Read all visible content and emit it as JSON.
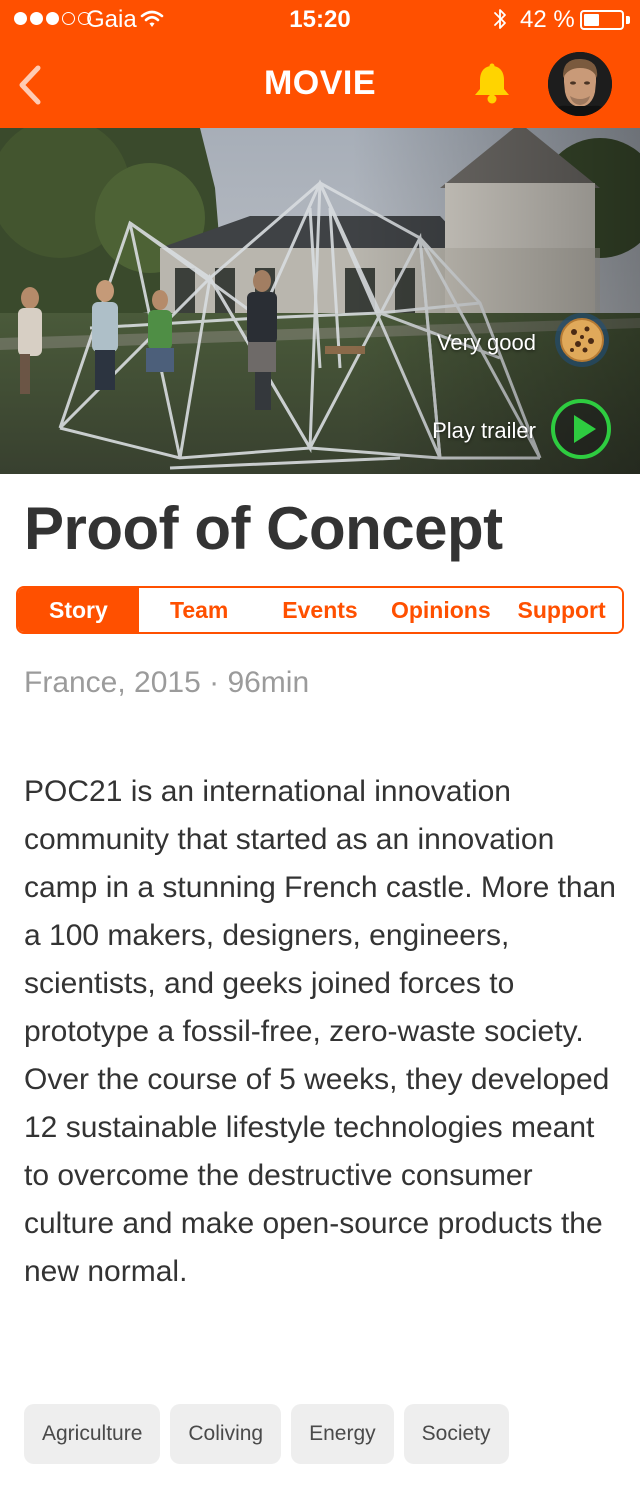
{
  "status_bar": {
    "carrier": "Gaia",
    "time": "15:20",
    "battery_percent": "42 %",
    "battery_level": 0.42,
    "signal_bars_filled": 3,
    "signal_bars_total": 5
  },
  "nav": {
    "title": "MOVIE",
    "back_icon": "chevron-left-icon",
    "bell_icon": "bell-icon",
    "accent_color": "#ff5000",
    "bell_color": "#ffd400"
  },
  "hero": {
    "rating_label": "Very good",
    "rating_icon": "cookie-icon",
    "trailer_label": "Play trailer",
    "trailer_icon": "play-icon",
    "play_color": "#2ecc40"
  },
  "movie": {
    "title": "Proof of Concept",
    "meta": "France, 2015 · 96min",
    "description": "POC21 is an international innovation community that started as an innovation camp in a stunning French castle. More than a 100 makers, designers, engineers, scientists, and geeks joined forces to prototype a fossil-free, zero-waste society. Over the course of 5 weeks, they developed 12 sustainable lifestyle technologies meant to overcome the destructive consumer culture and make open-source products the new normal."
  },
  "tabs": {
    "active_index": 0,
    "items": [
      {
        "label": "Story"
      },
      {
        "label": "Team"
      },
      {
        "label": "Events"
      },
      {
        "label": "Opinions"
      },
      {
        "label": "Support"
      }
    ]
  },
  "tags": [
    {
      "label": "Agriculture"
    },
    {
      "label": "Coliving"
    },
    {
      "label": "Energy"
    },
    {
      "label": "Society"
    }
  ]
}
